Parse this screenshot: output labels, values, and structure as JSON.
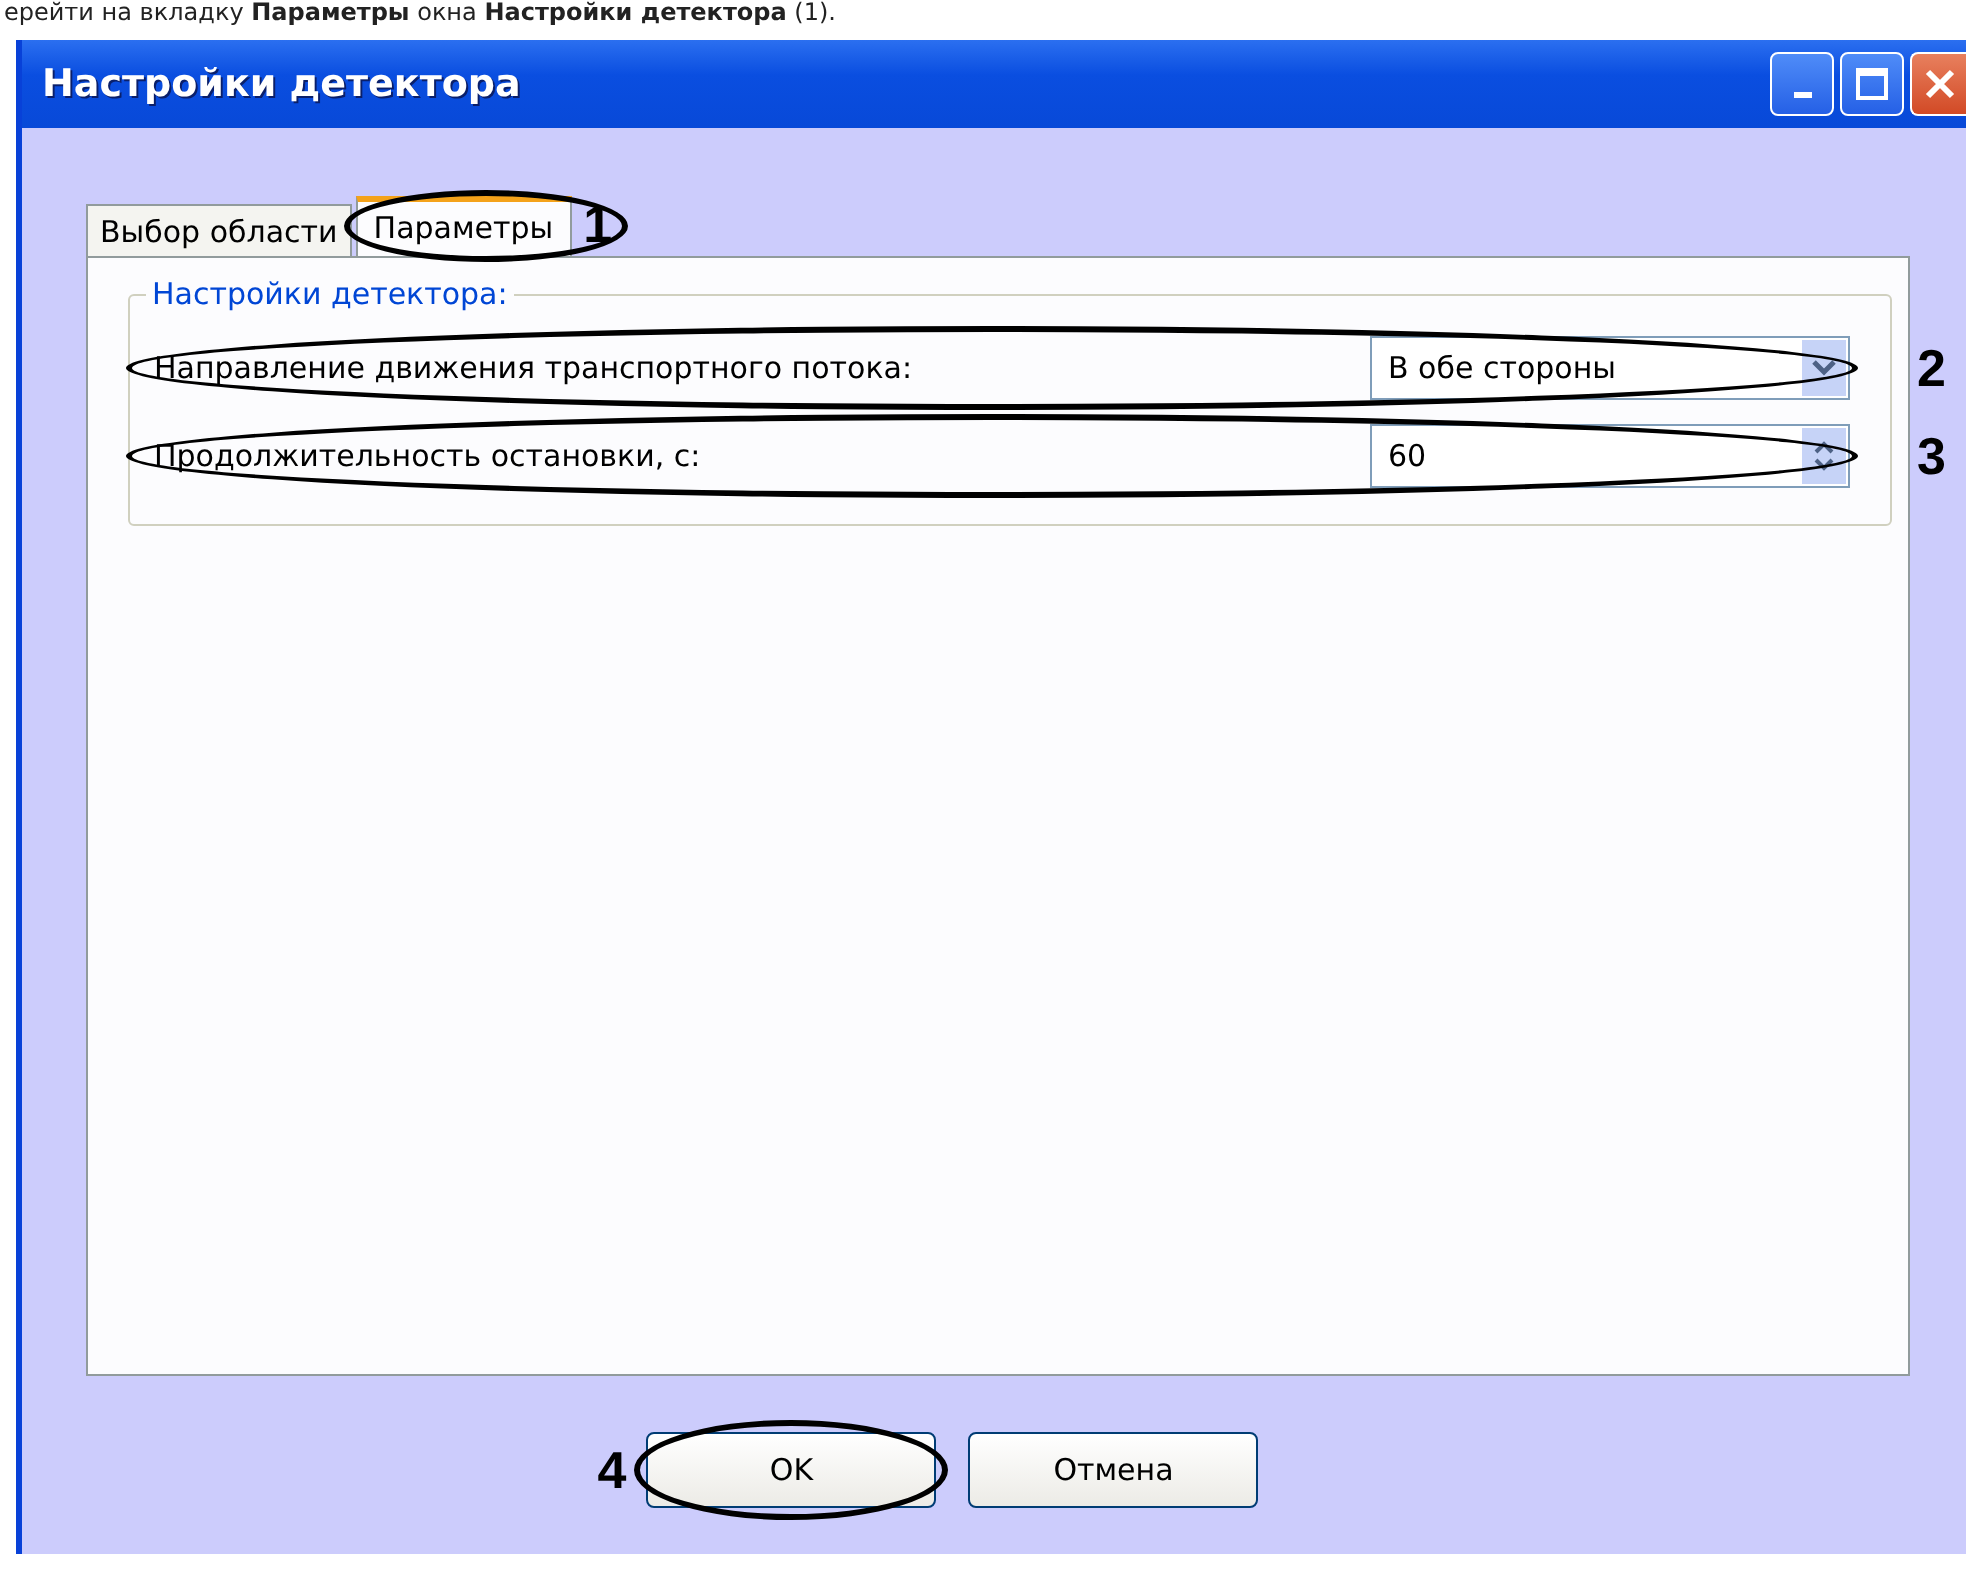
{
  "caption": "ерейти на вкладку **Параметры** окна **Настройки детектора** (1).",
  "window": {
    "title": "Настройки детектора"
  },
  "tabs": [
    {
      "label": "Выбор области",
      "selected": false
    },
    {
      "label": "Параметры",
      "selected": true,
      "callout": "1"
    }
  ],
  "group": {
    "title": "Настройки детектора:",
    "fields": [
      {
        "kind": "dropdown",
        "label": "Направление движения транспортного потока:",
        "value": "В обе стороны",
        "callout": "2"
      },
      {
        "kind": "spinner",
        "label": "Продолжительность остановки, с:",
        "value": "60",
        "callout": "3"
      }
    ]
  },
  "buttons": [
    {
      "label": "OK",
      "callout": "4"
    },
    {
      "label": "Отмена"
    }
  ]
}
